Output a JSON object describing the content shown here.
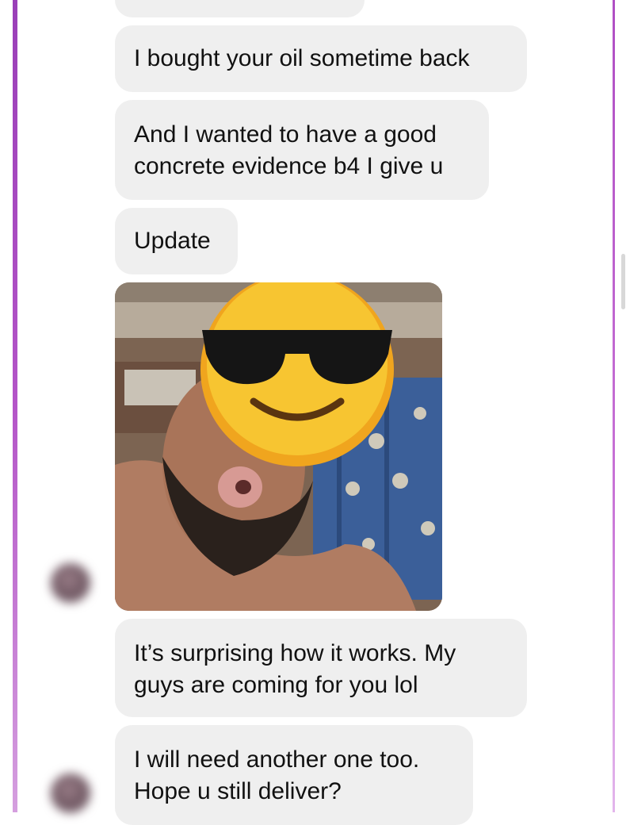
{
  "messages": [
    {
      "lines": [
        "I bought your oil sometime back"
      ]
    },
    {
      "lines": [
        "And I wanted to have a good",
        "concrete evidence b4 I give u"
      ]
    },
    {
      "lines": [
        "Update"
      ]
    },
    {
      "lines": [
        "It’s surprising how it works.  My",
        "guys are coming for you lol"
      ]
    },
    {
      "lines": [
        "I will need another one too.",
        "Hope u still deliver?"
      ]
    }
  ],
  "photo": {
    "description_icon": "sunglasses-emoji-icon"
  },
  "colors": {
    "bubble": "#efefef",
    "text": "#111111",
    "frame_accent": "#b455c8",
    "emoji_face": "#f7c531"
  }
}
